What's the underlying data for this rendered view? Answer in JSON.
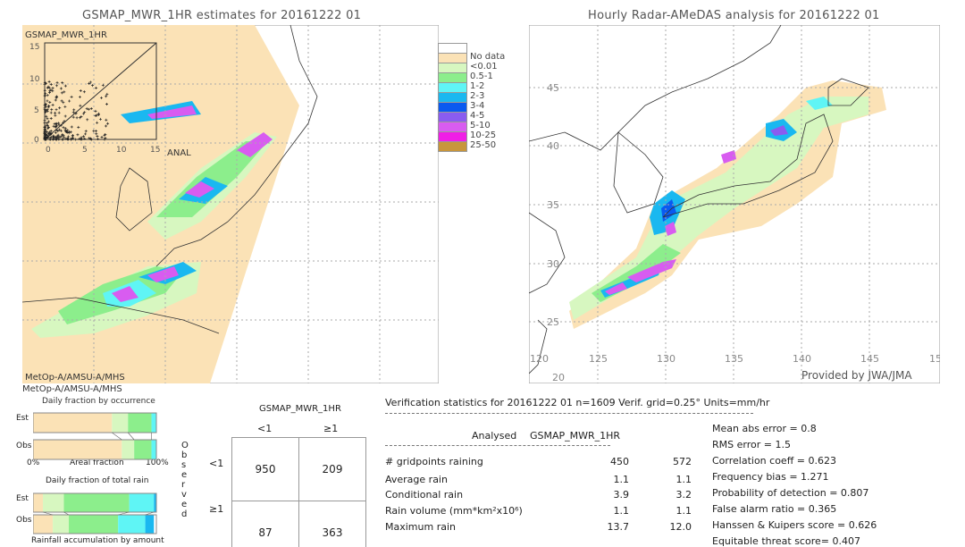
{
  "left_map": {
    "title": "GSMAP_MWR_1HR estimates for 20161222 01",
    "inset_label": "GSMAP_MWR_1HR",
    "inset_xlabel": "ANAL",
    "inset_ticks": [
      "0",
      "5",
      "10",
      "15"
    ],
    "sensor_text_inside": "MetOp-A/AMSU-A/MHS",
    "sensor_text_below": "MetOp-A/AMSU-A/MHS"
  },
  "right_map": {
    "title": "Hourly Radar-AMeDAS analysis for 20161222 01",
    "lat_ticks": [
      "50",
      "45",
      "40",
      "35",
      "30",
      "25",
      "20"
    ],
    "lon_ticks": [
      "120",
      "125",
      "130",
      "135",
      "140",
      "145",
      "15"
    ],
    "credit": "Provided by JWA/JMA"
  },
  "legend": {
    "items": [
      {
        "label": "",
        "color": "#ffffff"
      },
      {
        "label": "No data",
        "color": "#fbe2b6"
      },
      {
        "label": "<0.01",
        "color": "#d7f7c0"
      },
      {
        "label": "0.5-1",
        "color": "#8cee8c"
      },
      {
        "label": "1-2",
        "color": "#5ff5f5"
      },
      {
        "label": "2-3",
        "color": "#1ab8f0"
      },
      {
        "label": "3-4",
        "color": "#0a5af0"
      },
      {
        "label": "4-5",
        "color": "#8a5cf0"
      },
      {
        "label": "5-10",
        "color": "#d85cf0"
      },
      {
        "label": "10-25",
        "color": "#f01ee6"
      },
      {
        "label": "25-50",
        "color": "#c8963c"
      }
    ]
  },
  "fraction_charts": {
    "occurrence_title": "Daily fraction by occurrence",
    "est_label": "Est",
    "obs_label": "Obs",
    "axis_left": "0%",
    "axis_mid": "Areal fraction",
    "axis_right": "100%",
    "total_title": "Daily fraction of total rain",
    "accum_label": "Rainfall accumulation by amount"
  },
  "contingency": {
    "header": "GSMAP_MWR_1HR",
    "col_labels": [
      "<1",
      "≥1"
    ],
    "row_labels": [
      "<1",
      "≥1"
    ],
    "side_label": "Observed",
    "cells": [
      [
        "950",
        "209"
      ],
      [
        "87",
        "363"
      ]
    ]
  },
  "stats": {
    "header": "Verification statistics for 20161222 01   n=1609   Verif. grid=0.25°   Units=mm/hr",
    "col_analysed": "Analysed",
    "col_gsmap": "GSMAP_MWR_1HR",
    "rows": [
      {
        "label": "# gridpoints raining",
        "analysed": "450",
        "gsmap": "572"
      },
      {
        "label": "Average rain",
        "analysed": "1.1",
        "gsmap": "1.1"
      },
      {
        "label": "Conditional rain",
        "analysed": "3.9",
        "gsmap": "3.2"
      },
      {
        "label": "Rain volume (mm*km²x10⁶)",
        "analysed": "1.1",
        "gsmap": "1.1"
      },
      {
        "label": "Maximum rain",
        "analysed": "13.7",
        "gsmap": "12.0"
      }
    ],
    "scores": [
      "Mean abs error = 0.8",
      "RMS error = 1.5",
      "Correlation coeff = 0.623",
      "Frequency bias = 1.271",
      "Probability of detection = 0.807",
      "False alarm ratio = 0.365",
      "Hanssen & Kuipers score = 0.626",
      "Equitable threat score= 0.407"
    ]
  },
  "chart_data": [
    {
      "type": "bar",
      "title": "Daily fraction by occurrence",
      "categories": [
        "Est",
        "Obs"
      ],
      "stacked": true,
      "xlabel": "Areal fraction",
      "series": [
        {
          "color": "#fbe2b6",
          "values": [
            0.64,
            0.72
          ]
        },
        {
          "color": "#d7f7c0",
          "values": [
            0.13,
            0.1
          ]
        },
        {
          "color": "#8cee8c",
          "values": [
            0.19,
            0.14
          ]
        },
        {
          "color": "#5ff5f5",
          "values": [
            0.04,
            0.04
          ]
        }
      ]
    },
    {
      "type": "bar",
      "title": "Daily fraction of total rain",
      "xlabel": "Rainfall accumulation by amount",
      "categories": [
        "Est",
        "Obs"
      ],
      "stacked": true,
      "series": [
        {
          "color": "#fbe2b6",
          "values": [
            0.08,
            0.16
          ]
        },
        {
          "color": "#d7f7c0",
          "values": [
            0.17,
            0.13
          ]
        },
        {
          "color": "#8cee8c",
          "values": [
            0.53,
            0.4
          ]
        },
        {
          "color": "#5ff5f5",
          "values": [
            0.2,
            0.22
          ]
        },
        {
          "color": "#1ab8f0",
          "values": [
            0.02,
            0.07
          ]
        }
      ]
    }
  ]
}
